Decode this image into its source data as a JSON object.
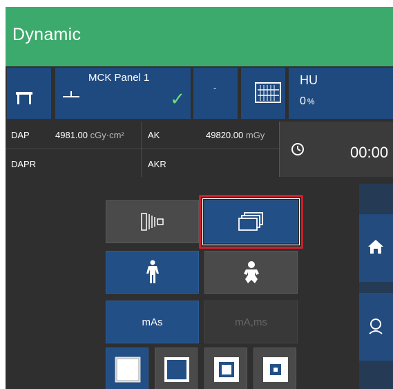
{
  "header": {
    "title": "Dynamic"
  },
  "toolbar": {
    "panel_label": "MCK Panel 1",
    "panel_status": "✓",
    "dash_label": "-",
    "hu_label": "HU",
    "hu_value": "0",
    "hu_unit": "%"
  },
  "dose": {
    "dap_label": "DAP",
    "dap_value": "4981.00",
    "dap_unit": "cGy·cm²",
    "ak_label": "AK",
    "ak_value": "49820.00",
    "ak_unit": "mGy",
    "dapr_label": "DAPR",
    "akr_label": "AKR"
  },
  "timer": {
    "time": "00:00"
  },
  "controls": {
    "mas_label": "mAs",
    "mams_label": "mA,ms"
  },
  "colors": {
    "header": "#3daa6d",
    "selected": "#224f86",
    "highlight": "#cc1f2b",
    "check": "#6ee07a"
  }
}
